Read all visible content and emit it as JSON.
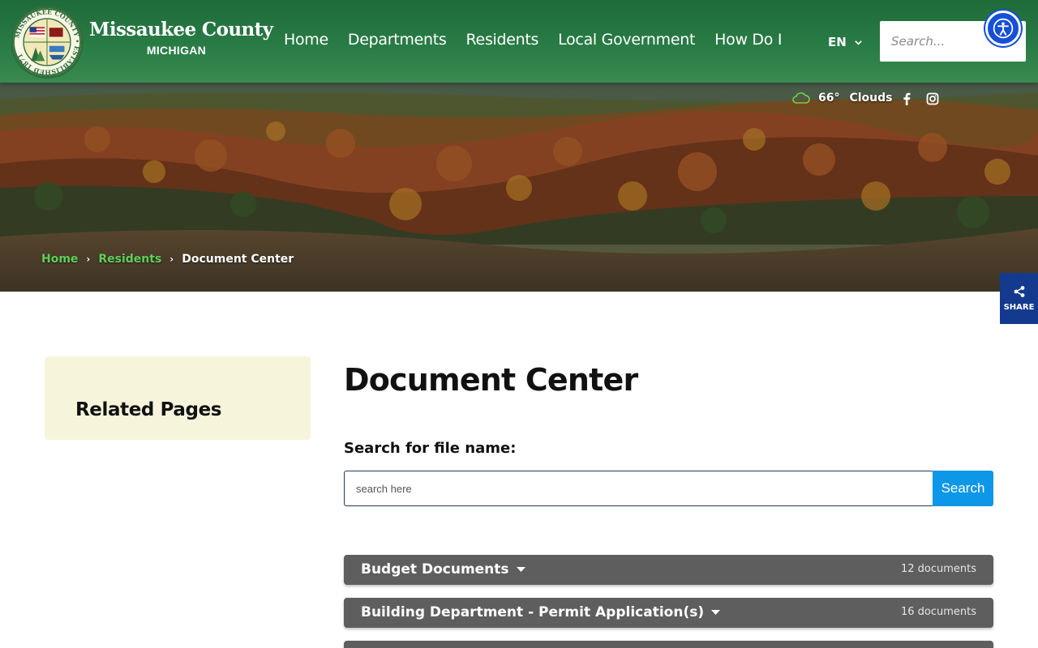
{
  "header": {
    "logo": {
      "name": "Missaukee County",
      "state": "MICHIGAN",
      "seal_text": "MISSAUKEE COUNTY • ESTABLISHED 1871"
    },
    "nav": [
      "Home",
      "Departments",
      "Residents",
      "Local Government",
      "How Do I"
    ],
    "language": "EN",
    "search_placeholder": "Search..."
  },
  "hero": {
    "weather": {
      "temperature": "66°",
      "condition": "Clouds",
      "icon": "cloud-icon"
    },
    "social": [
      "facebook-icon",
      "instagram-icon"
    ],
    "breadcrumb": {
      "home": "Home",
      "residents": "Residents",
      "current": "Document Center"
    }
  },
  "share": {
    "label": "SHARE"
  },
  "sidebar": {
    "title": "Related Pages"
  },
  "main": {
    "title": "Document Center",
    "search_label": "Search for file name:",
    "search_placeholder": "search here",
    "search_button": "Search",
    "folders": [
      {
        "name": "Budget Documents",
        "count": "12 documents"
      },
      {
        "name": "Building Department - Permit Application(s)",
        "count": "16 documents"
      }
    ]
  },
  "colors": {
    "header_green": "#2a7d46",
    "crumb_green": "#5fcf5a",
    "search_blue": "#0d97e8",
    "folder_gray": "#5e5e5e",
    "sidebar_bg": "#f6f5dc",
    "share_blue": "#143a8f",
    "a11y_blue": "#1550d6"
  }
}
